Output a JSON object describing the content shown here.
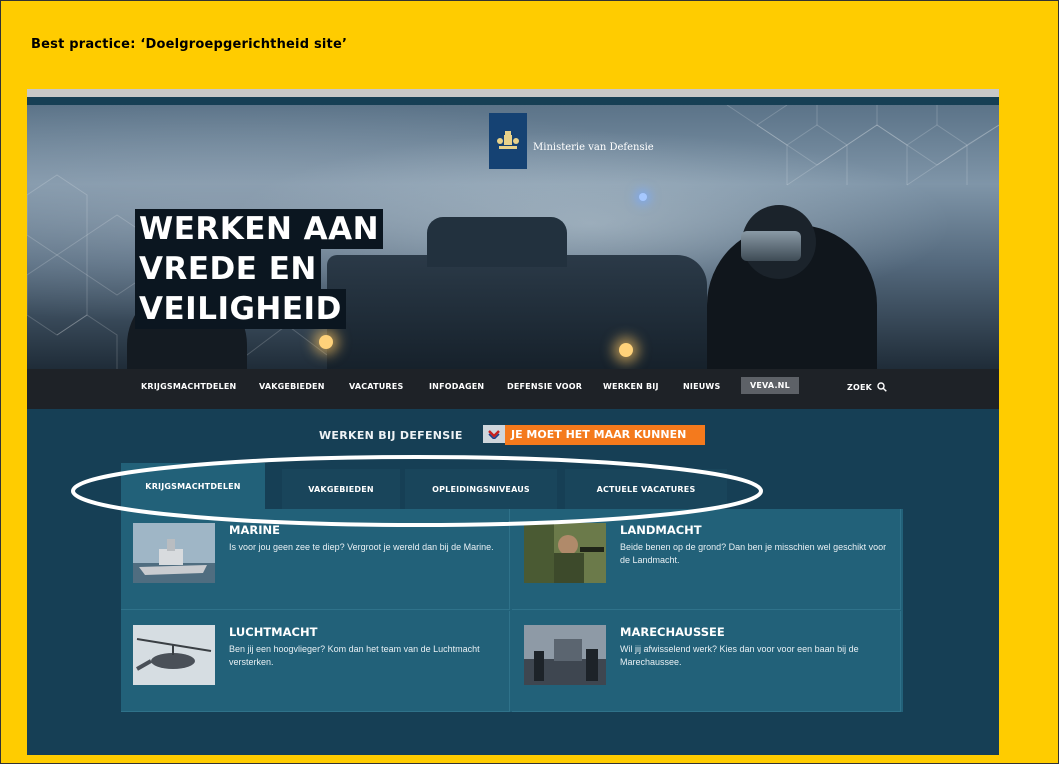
{
  "slide": {
    "title": "Best practice: ‘Doelgroepgerichtheid site’"
  },
  "hero": {
    "ministry": "Ministerie van Defensie",
    "headline": [
      "WERKEN AAN",
      "VREDE EN",
      "VEILIGHEID"
    ]
  },
  "nav": {
    "items": [
      "KRIJGSMACHTDELEN",
      "VAKGEBIEDEN",
      "VACATURES",
      "INFODAGEN",
      "DEFENSIE VOOR",
      "WERKEN BIJ",
      "NIEUWS"
    ],
    "veva": "VEVA.NL",
    "search": "ZOEK"
  },
  "tagline": {
    "left": "WERKEN BIJ DEFENSIE",
    "right": "JE MOET HET MAAR KUNNEN"
  },
  "tabs": [
    "KRIJGSMACHTDELEN",
    "VAKGEBIEDEN",
    "OPLEIDINGSNIVEAUS",
    "ACTUELE VACATURES"
  ],
  "active_tab": "KRIJGSMACHTDELEN",
  "cards": [
    {
      "title": "MARINE",
      "text": "Is voor jou geen zee te diep? Vergroot je wereld dan bij de Marine."
    },
    {
      "title": "LANDMACHT",
      "text": "Beide benen op de grond? Dan ben je misschien wel geschikt voor de Landmacht."
    },
    {
      "title": "LUCHTMACHT",
      "text": "Ben jij een hoogvlieger? Kom dan het team van de Luchtmacht versterken."
    },
    {
      "title": "MARECHAUSSEE",
      "text": "Wil jij afwisselend werk? Kies dan voor voor een baan bij de Marechaussee."
    }
  ],
  "colors": {
    "slide_bg": "#ffcc00",
    "nav_bg": "#1e2227",
    "tab_bg": "#19455b",
    "card_bg": "#226179",
    "orange": "#f47a1d",
    "logo_blue": "#154273"
  }
}
